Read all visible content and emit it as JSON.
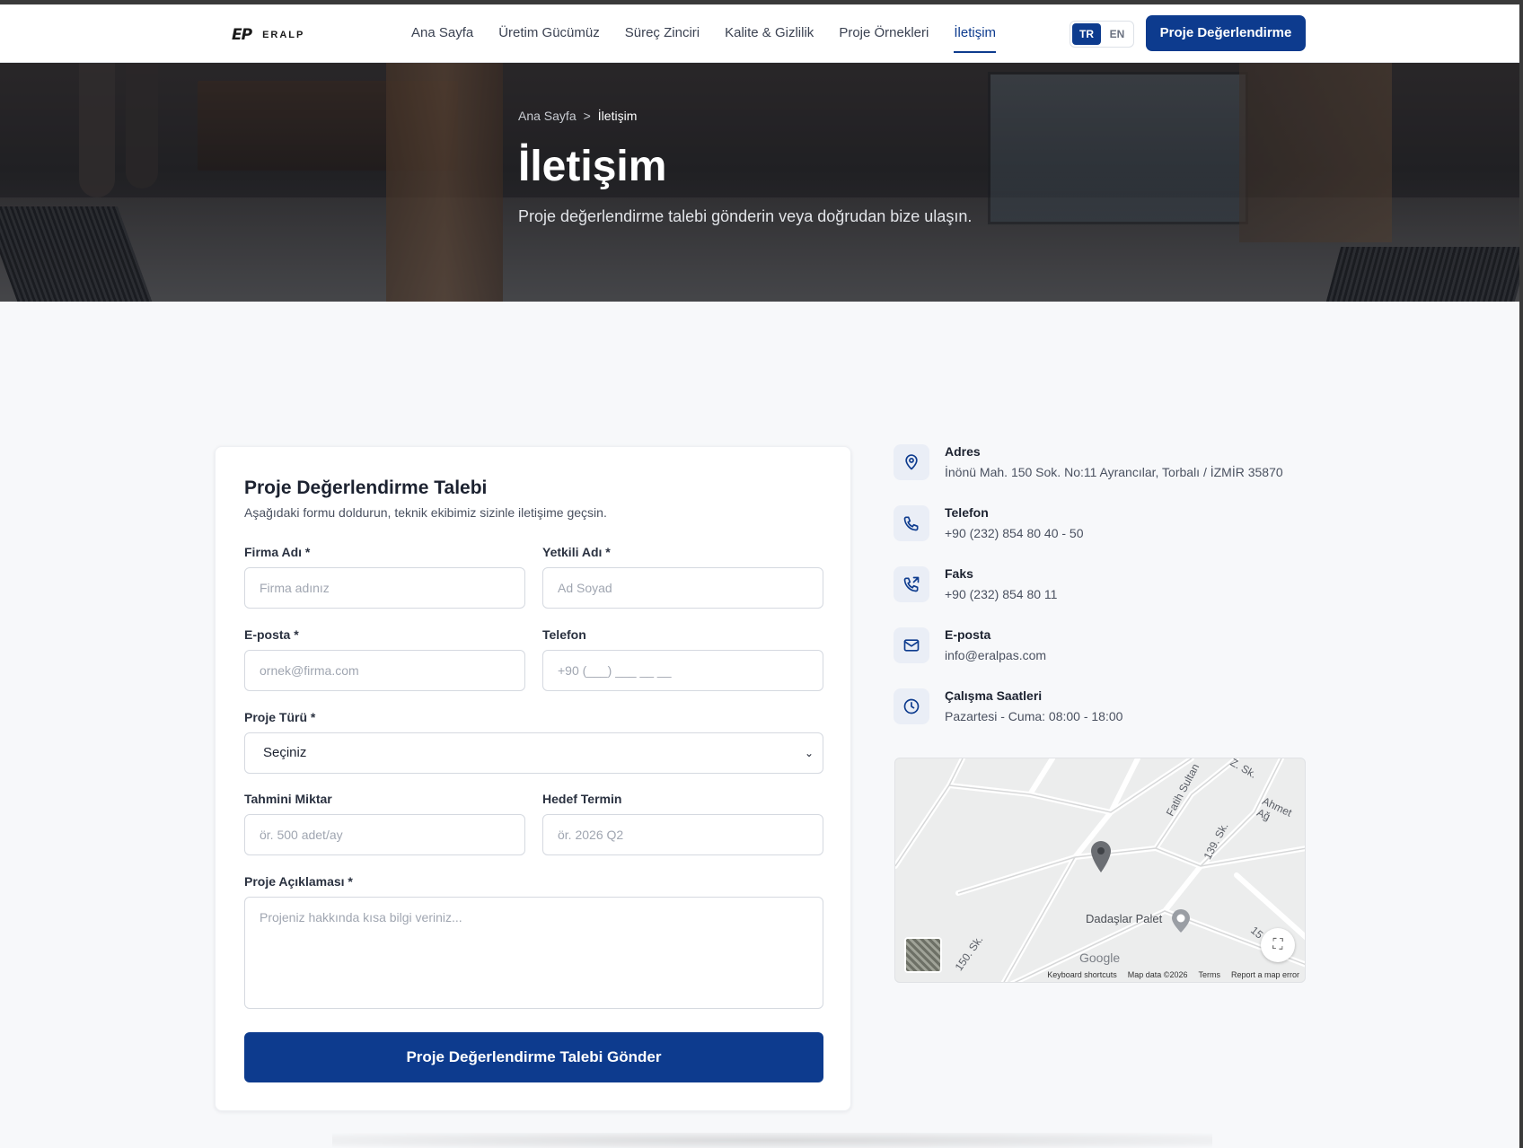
{
  "header": {
    "logo_mark": "EP",
    "logo_text": "ERALP",
    "nav": [
      {
        "label": "Ana Sayfa"
      },
      {
        "label": "Üretim Gücümüz"
      },
      {
        "label": "Süreç Zinciri"
      },
      {
        "label": "Kalite & Gizlilik"
      },
      {
        "label": "Proje Örnekleri"
      },
      {
        "label": "İletişim",
        "active": true
      }
    ],
    "lang": {
      "tr": "TR",
      "en": "EN",
      "active": "TR"
    },
    "cta": "Proje Değerlendirme"
  },
  "hero": {
    "breadcrumb": {
      "home": "Ana Sayfa",
      "separator": ">",
      "current": "İletişim"
    },
    "title": "İletişim",
    "subtitle": "Proje değerlendirme talebi gönderin veya doğrudan bize ulaşın."
  },
  "form": {
    "title": "Proje Değerlendirme Talebi",
    "subtitle": "Aşağıdaki formu doldurun, teknik ekibimiz sizinle iletişime geçsin.",
    "company": {
      "label": "Firma Adı *",
      "placeholder": "Firma adınız"
    },
    "contact_name": {
      "label": "Yetkili Adı *",
      "placeholder": "Ad Soyad"
    },
    "email": {
      "label": "E-posta *",
      "placeholder": "ornek@firma.com"
    },
    "phone": {
      "label": "Telefon",
      "placeholder": "+90 (___) ___ __ __"
    },
    "project_type": {
      "label": "Proje Türü *",
      "value": "Seçiniz"
    },
    "quantity": {
      "label": "Tahmini Miktar",
      "placeholder": "ör. 500 adet/ay"
    },
    "deadline": {
      "label": "Hedef Termin",
      "placeholder": "ör. 2026 Q2"
    },
    "description": {
      "label": "Proje Açıklaması *",
      "placeholder": "Projeniz hakkında kısa bilgi veriniz..."
    },
    "submit": "Proje Değerlendirme Talebi Gönder"
  },
  "contact": {
    "address": {
      "label": "Adres",
      "value": "İnönü Mah. 150 Sok. No:11 Ayrancılar, Torbalı / İZMİR 35870",
      "icon": "map-pin-icon"
    },
    "phone": {
      "label": "Telefon",
      "value": "+90 (232) 854 80 40 - 50",
      "icon": "phone-icon"
    },
    "fax": {
      "label": "Faks",
      "value": "+90 (232) 854 80 11",
      "icon": "phone-forward-icon"
    },
    "email": {
      "label": "E-posta",
      "value": "info@eralpas.com",
      "icon": "mail-icon"
    },
    "hours": {
      "label": "Çalışma Saatleri",
      "value": "Pazartesi - Cuma: 08:00 - 18:00",
      "icon": "clock-icon"
    }
  },
  "map": {
    "streets": [
      "Fatih Sultan",
      "Z. Sk.",
      "Ahmet Ağ",
      "139. Sk.",
      "150. Sk.",
      "15"
    ],
    "place": "Dadaşlar Palet",
    "google": "Google",
    "footer": [
      "Keyboard shortcuts",
      "Map data ©2026",
      "Terms",
      "Report a map error"
    ]
  },
  "colors": {
    "primary": "#0d3b8e",
    "background": "#f7f8fa",
    "icon_bg": "#eaeef6"
  }
}
